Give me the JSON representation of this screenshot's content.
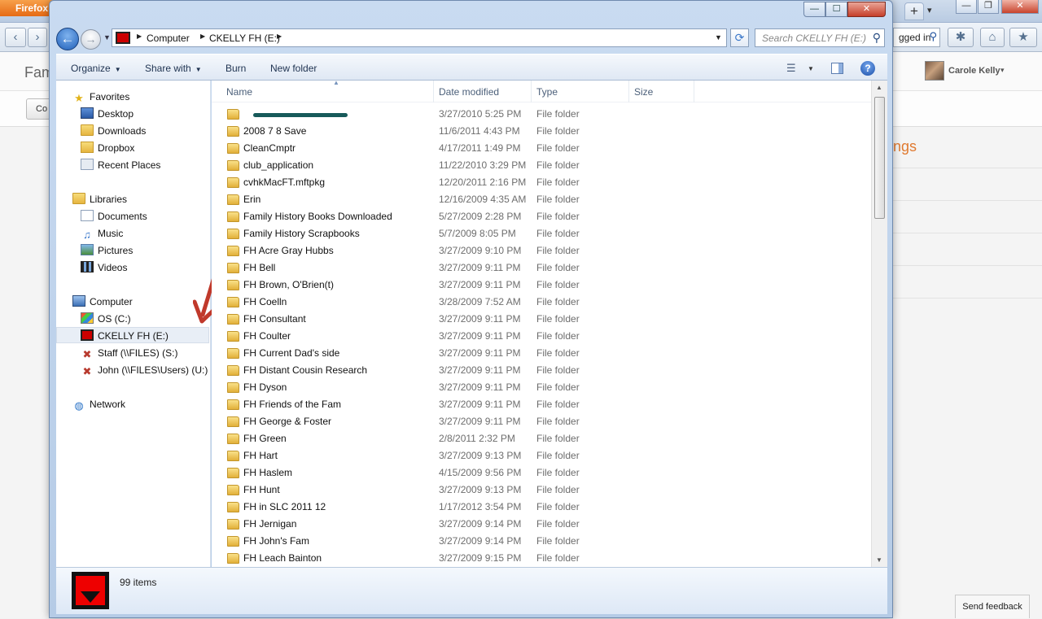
{
  "browser": {
    "menu_label": "Firefox",
    "new_tab_label": "+",
    "tab_list_glyph": "▾",
    "search_tail_text": "gged in",
    "controls": {
      "minimize": "—",
      "restore": "❐",
      "close": "✕"
    },
    "nav_glyphs": {
      "back": "‹",
      "forward": "›",
      "tools": "✱",
      "home": "⌂",
      "star_menu": "★"
    }
  },
  "page": {
    "fam_text": "Fam",
    "co_button": "Co",
    "settings_link_text": "tings",
    "user_name": "Carole Kelly",
    "user_caret": "▾",
    "feedback_label": "Send feedback"
  },
  "explorer": {
    "controls": {
      "minimize": "—",
      "maximize": "☐",
      "close": "✕"
    },
    "back_glyph": "←",
    "forward_glyph": "→",
    "address": {
      "crumbs": [
        "Computer",
        "CKELLY FH (E:)"
      ],
      "separator": "▶"
    },
    "refresh_glyph": "⟳",
    "search_placeholder": "Search CKELLY FH (E:)",
    "toolbar": {
      "organize": "Organize",
      "share_with": "Share with",
      "burn": "Burn",
      "new_folder": "New folder",
      "views_glyph": "☰",
      "help_glyph": "?"
    },
    "nav": {
      "favorites": {
        "label": "Favorites",
        "items": [
          "Desktop",
          "Downloads",
          "Dropbox",
          "Recent Places"
        ]
      },
      "libraries": {
        "label": "Libraries",
        "items": [
          "Documents",
          "Music",
          "Pictures",
          "Videos"
        ]
      },
      "computer": {
        "label": "Computer",
        "items": [
          "OS (C:)",
          "CKELLY FH (E:)",
          "Staff (\\\\FILES) (S:)",
          "John (\\\\FILES\\Users) (U:)"
        ]
      },
      "network": {
        "label": "Network"
      },
      "selected": "CKELLY FH (E:)"
    },
    "columns": {
      "name": "Name",
      "date": "Date modified",
      "type": "Type",
      "size": "Size"
    },
    "files": [
      {
        "name": "",
        "date": "3/27/2010 5:25 PM",
        "type": "File folder"
      },
      {
        "name": "2008 7 8 Save",
        "date": "11/6/2011 4:43 PM",
        "type": "File folder"
      },
      {
        "name": "CleanCmptr",
        "date": "4/17/2011 1:49 PM",
        "type": "File folder"
      },
      {
        "name": "club_application",
        "date": "11/22/2010 3:29 PM",
        "type": "File folder"
      },
      {
        "name": "cvhkMacFT.mftpkg",
        "date": "12/20/2011 2:16 PM",
        "type": "File folder"
      },
      {
        "name": "Erin",
        "date": "12/16/2009 4:35 AM",
        "type": "File folder"
      },
      {
        "name": "Family History Books Downloaded",
        "date": "5/27/2009 2:28 PM",
        "type": "File folder"
      },
      {
        "name": "Family History Scrapbooks",
        "date": "5/7/2009 8:05 PM",
        "type": "File folder"
      },
      {
        "name": "FH Acre Gray Hubbs",
        "date": "3/27/2009 9:10 PM",
        "type": "File folder"
      },
      {
        "name": "FH Bell",
        "date": "3/27/2009 9:11 PM",
        "type": "File folder"
      },
      {
        "name": "FH Brown, O'Brien(t)",
        "date": "3/27/2009 9:11 PM",
        "type": "File folder"
      },
      {
        "name": "FH Coelln",
        "date": "3/28/2009 7:52 AM",
        "type": "File folder"
      },
      {
        "name": "FH Consultant",
        "date": "3/27/2009 9:11 PM",
        "type": "File folder"
      },
      {
        "name": "FH Coulter",
        "date": "3/27/2009 9:11 PM",
        "type": "File folder"
      },
      {
        "name": "FH Current Dad's side",
        "date": "3/27/2009 9:11 PM",
        "type": "File folder"
      },
      {
        "name": "FH Distant Cousin Research",
        "date": "3/27/2009 9:11 PM",
        "type": "File folder"
      },
      {
        "name": "FH Dyson",
        "date": "3/27/2009 9:11 PM",
        "type": "File folder"
      },
      {
        "name": "FH Friends of the Fam",
        "date": "3/27/2009 9:11 PM",
        "type": "File folder"
      },
      {
        "name": "FH George & Foster",
        "date": "3/27/2009 9:11 PM",
        "type": "File folder"
      },
      {
        "name": "FH Green",
        "date": "2/8/2011 2:32 PM",
        "type": "File folder"
      },
      {
        "name": "FH Hart",
        "date": "3/27/2009 9:13 PM",
        "type": "File folder"
      },
      {
        "name": "FH Haslem",
        "date": "4/15/2009 9:56 PM",
        "type": "File folder"
      },
      {
        "name": "FH Hunt",
        "date": "3/27/2009 9:13 PM",
        "type": "File folder"
      },
      {
        "name": "FH in SLC 2011 12",
        "date": "1/17/2012 3:54 PM",
        "type": "File folder"
      },
      {
        "name": "FH Jernigan",
        "date": "3/27/2009 9:14 PM",
        "type": "File folder"
      },
      {
        "name": "FH John's Fam",
        "date": "3/27/2009 9:14 PM",
        "type": "File folder"
      },
      {
        "name": "FH Leach Bainton",
        "date": "3/27/2009 9:15 PM",
        "type": "File folder"
      }
    ],
    "details": {
      "item_count": "99 items"
    },
    "scroll": {
      "up": "▲",
      "down": "▼"
    },
    "annotation_color": "#c0392b"
  }
}
